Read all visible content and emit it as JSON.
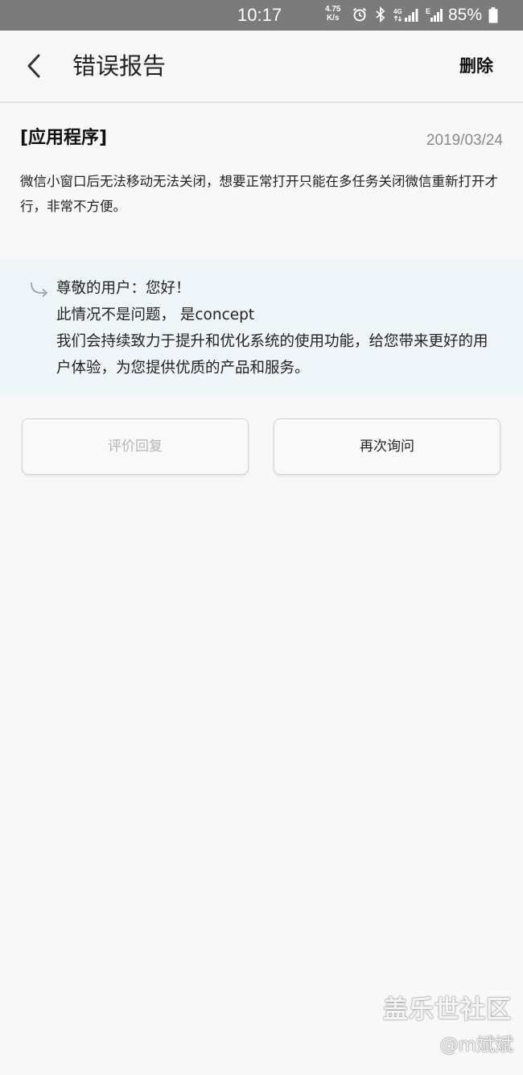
{
  "status_bar": {
    "time": "10:17",
    "net_speed_value": "4.75",
    "net_speed_unit": "K/s",
    "network_type": "4G",
    "battery_percent": "85%"
  },
  "header": {
    "title": "错误报告",
    "delete_label": "删除"
  },
  "report": {
    "category": "[应用程序]",
    "date": "2019/03/24",
    "description": "微信小窗口后无法移动无法关闭，想要正常打开只能在多任务关闭微信重新打开才行，非常不方便。"
  },
  "reply": {
    "greeting": "尊敬的用户：您好！",
    "line1": "此情况不是问题， 是concept",
    "line2": "我们会持续致力于提升和优化系统的使用功能，给您带来更好的用户体验，为您提供优质的产品和服务。"
  },
  "actions": {
    "rate_reply_label": "评价回复",
    "ask_again_label": "再次询问"
  },
  "watermark": {
    "site_name": "盖乐世社区",
    "user": "@m斌斌"
  }
}
